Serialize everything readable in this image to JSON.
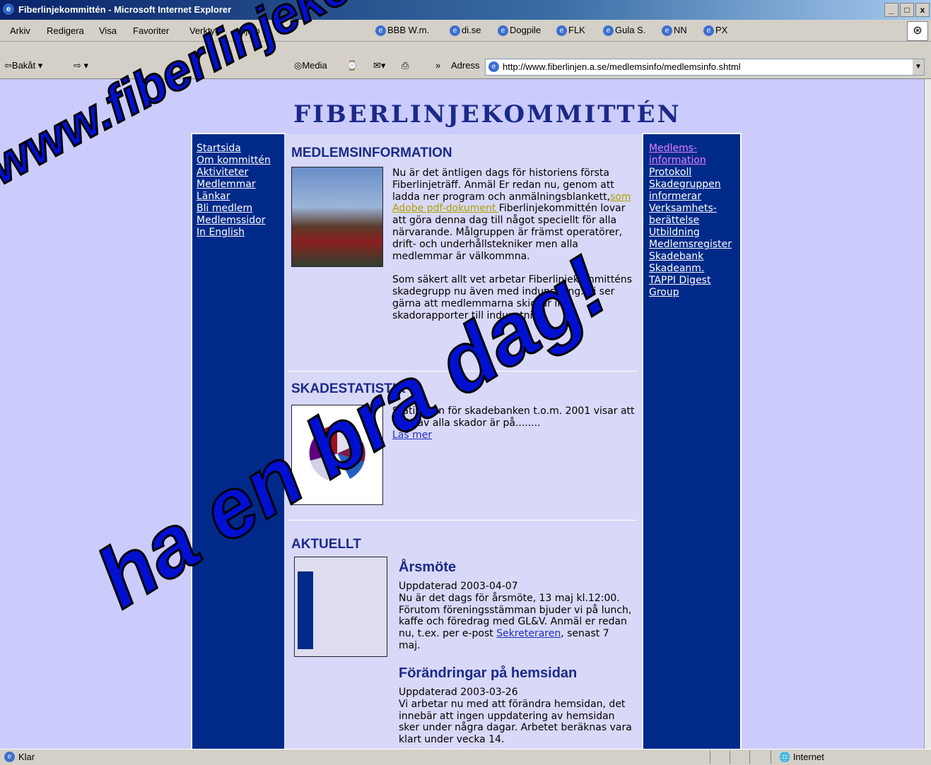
{
  "window": {
    "title": "Fiberlinjekommittén - Microsoft Internet Explorer",
    "controls": [
      "_",
      "□",
      "x"
    ]
  },
  "menubar": {
    "items": [
      "Arkiv",
      "Redigera",
      "Visa",
      "Favoriter",
      "Verktyg",
      "Hjälp"
    ],
    "links": [
      "BBB W.m.",
      "di.se",
      "Dogpile",
      "FLK",
      "Gula S.",
      "NN",
      "PX"
    ]
  },
  "toolbar": {
    "back": "Bakåt",
    "media": "Media",
    "more": "»",
    "address_label": "Adress",
    "address_url": "http://www.fiberlinjen.a.se/medlemsinfo/medlemsinfo.shtml"
  },
  "page": {
    "site_title": "FIBERLINJEKOMMITTÉN",
    "left_nav": [
      "Startsida",
      "Om kommittén",
      "Aktiviteter",
      "Medlemmar",
      "Länkar",
      "Bli medlem",
      "Medlemssidor",
      "In English"
    ],
    "right_nav": [
      "Medlems-",
      "information",
      "Protokoll",
      "Skadegruppen",
      "informerar",
      "Verksamhets-",
      "berättelse",
      "Utbildning",
      "Medlemsregister",
      "Skadebank",
      "Skadeanm.",
      "TAPPI Digest",
      "Group"
    ],
    "member_info": {
      "heading": "MEDLEMSINFORMATION",
      "para1_a": "Nu är det äntligen dags för historiens första Fiberlinjeträff. Anmäl Er redan nu, genom att ladda ner program och anmälningsblankett,",
      "para1_link": "som Adobe pdf-dokument ",
      "para1_b": "Fiberlinjekommittén lovar att göra denna dag till något speciellt för alla närvarande. Målgruppen är främst operatörer, drift- och underhållstekniker men alla medlemmar är välkommna.",
      "para2": "Som säkert allt vet arbetar Fiberlinjekommitténs skadegrupp nu även med indunstning. Vi ser gärna att medlemmarna skickar in skadorapporter till indunstning."
    },
    "skadestatistik": {
      "heading": "SKADESTATISTIK",
      "text": "Statistiken för skadebanken t.o.m. 2001 visar att 60% av alla skador är på........",
      "link": "Läs mer"
    },
    "aktuellt": {
      "heading": "AKTUELLT",
      "news": [
        {
          "title": "Årsmöte",
          "updated": "Uppdaterad 2003-04-07",
          "text_a": "Nu är det dags för årsmöte, 13 maj kl.12:00. Förutom föreningsstämman bjuder vi på lunch, kaffe och föredrag med GL&V. Anmäl er redan nu, t.ex. per e-post",
          "link": "Sekreteraren",
          "text_b": ", senast 7 maj."
        },
        {
          "title": "Förändringar på hemsidan",
          "updated": "Uppdaterad 2003-03-26",
          "text": "Vi arbetar nu med att förändra hemsidan, det innebär att ingen uppdatering av hemsidan sker under några dagar. Arbetet beräknas vara klart under vecka 14."
        }
      ]
    }
  },
  "overlay": {
    "text1": "www.fiberlinjekommittén",
    "text2": "ha en bra dag!"
  },
  "statusbar": {
    "status": "Klar",
    "zone": "Internet"
  },
  "colors": {
    "page_bg": "#ccccfc",
    "nav_bg": "#002a8a",
    "heading": "#1a2a8a",
    "overlay": "#0010d0"
  }
}
